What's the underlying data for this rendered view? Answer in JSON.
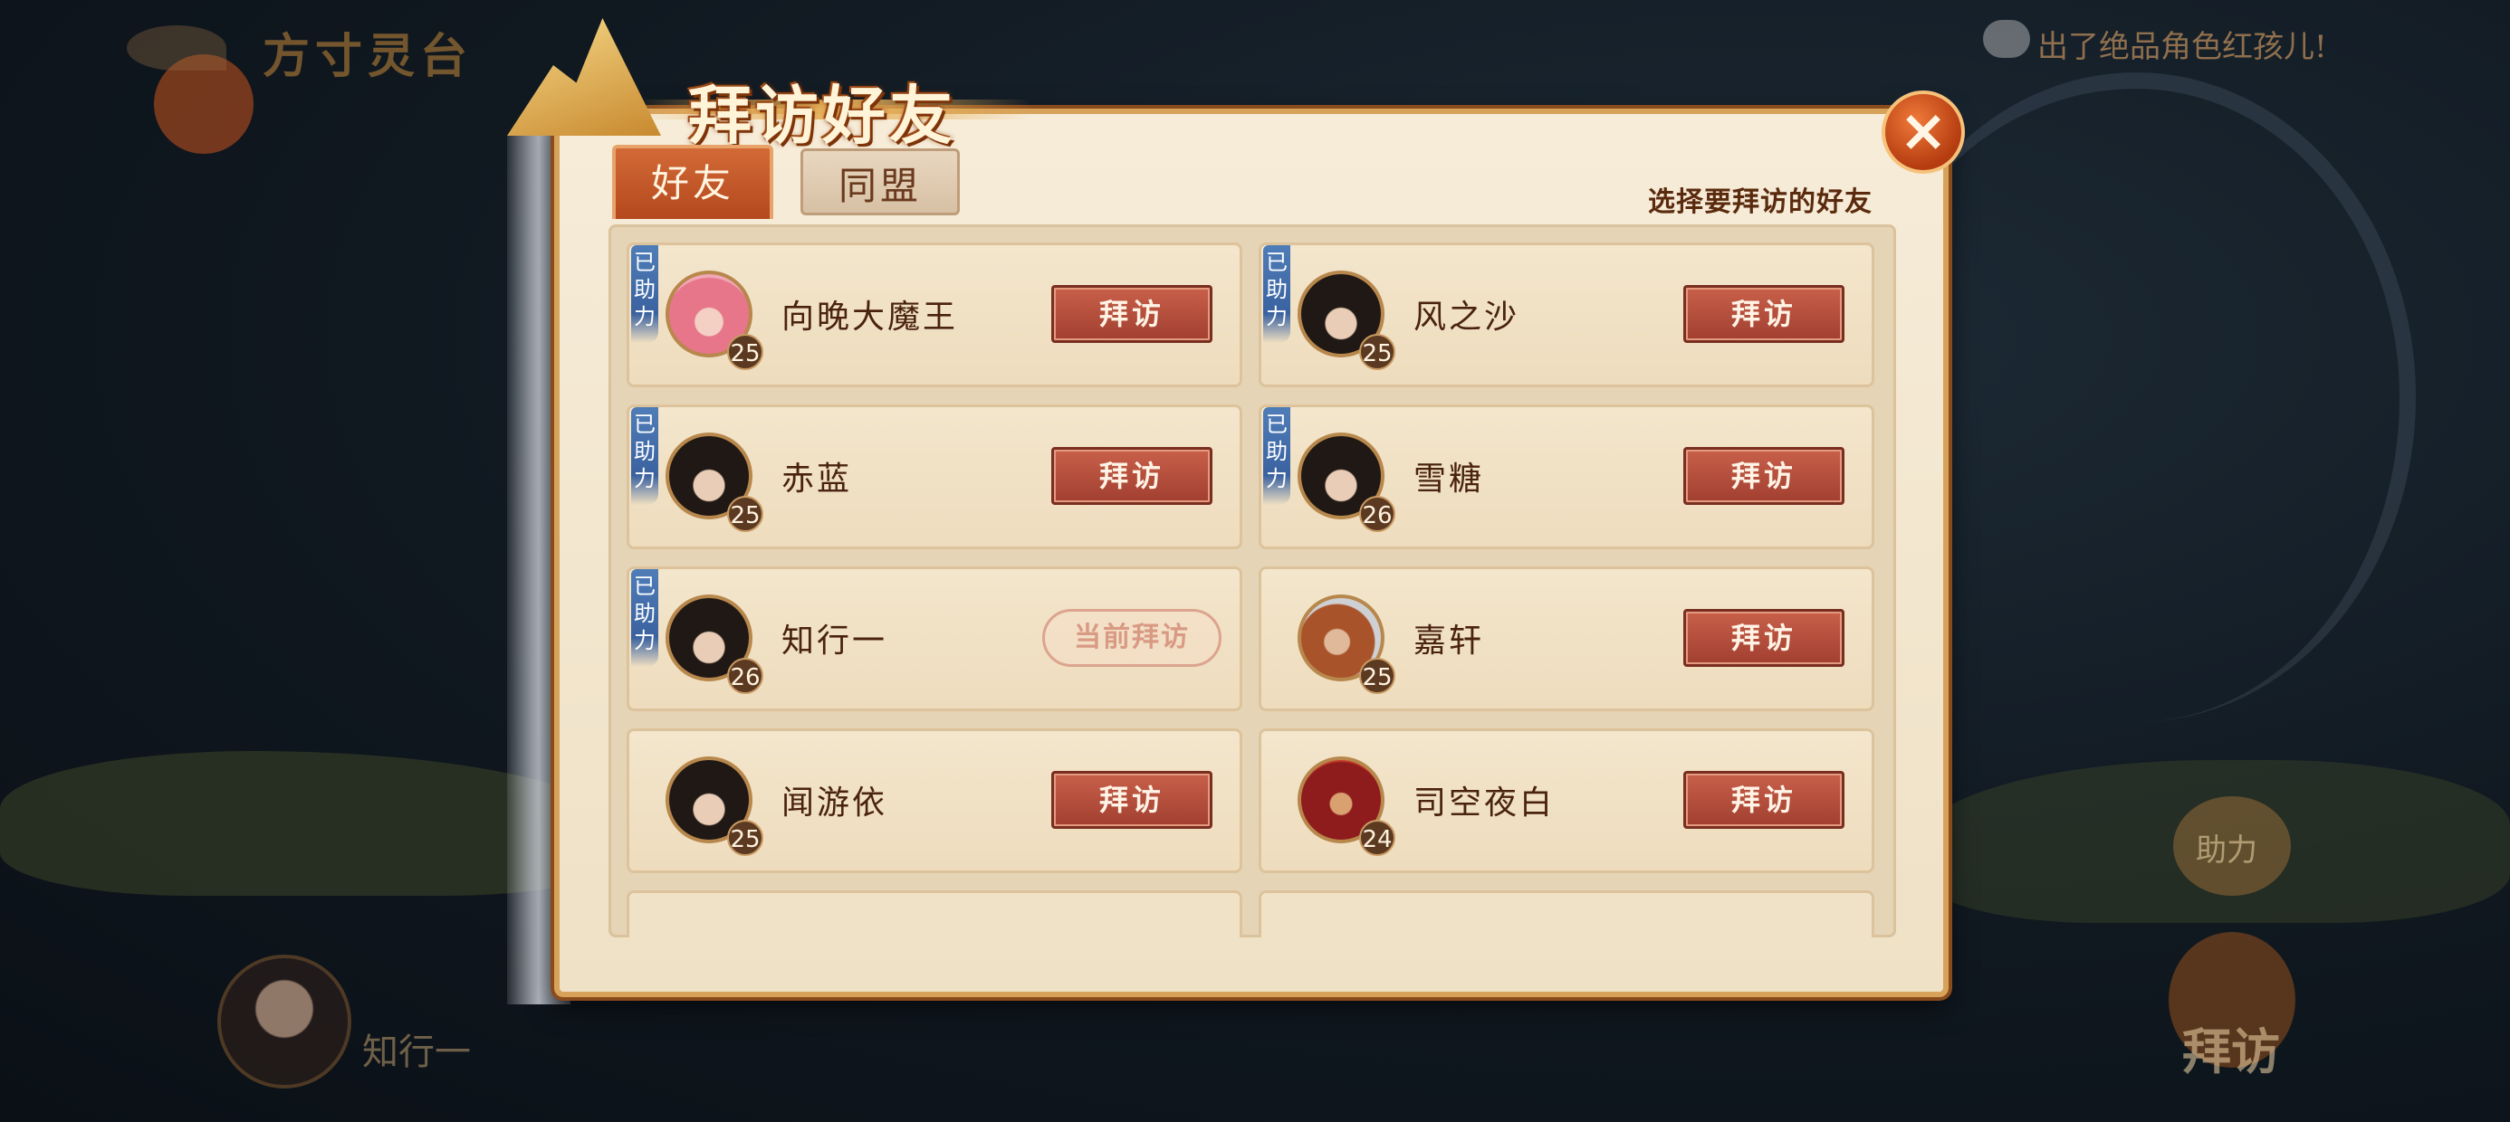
{
  "background": {
    "location_title": "方寸灵台",
    "chat_message": "出了绝品角色红孩儿!",
    "player_name": "知行一",
    "help_label": "助力",
    "visit_label": "拜访"
  },
  "dialog": {
    "title": "拜访好友",
    "close_icon": "×",
    "tabs": [
      {
        "label": "好友",
        "active": true
      },
      {
        "label": "同盟",
        "active": false
      }
    ],
    "hint": "选择要拜访的好友",
    "helped_tag": "已助力",
    "visit_button": "拜访",
    "current_visit": "当前拜访",
    "friends": [
      {
        "name": "向晚大魔王",
        "level": "25",
        "helped": true,
        "avatar": "pink-hair-avatar",
        "status": "visit"
      },
      {
        "name": "风之沙",
        "level": "25",
        "helped": true,
        "avatar": "dark-hair-avatar",
        "status": "visit"
      },
      {
        "name": "赤蓝",
        "level": "25",
        "helped": true,
        "avatar": "dark-hair-avatar",
        "status": "visit"
      },
      {
        "name": "雪糖",
        "level": "26",
        "helped": true,
        "avatar": "dark-hair-avatar",
        "status": "visit"
      },
      {
        "name": "知行一",
        "level": "26",
        "helped": true,
        "avatar": "dark-hair-avatar",
        "status": "current"
      },
      {
        "name": "嘉轩",
        "level": "25",
        "helped": false,
        "avatar": "brown-hair-avatar",
        "status": "visit"
      },
      {
        "name": "闻游依",
        "level": "25",
        "helped": false,
        "avatar": "dark-hair-avatar",
        "status": "visit"
      },
      {
        "name": "司空夜白",
        "level": "24",
        "helped": false,
        "avatar": "red-mask-avatar",
        "status": "visit"
      }
    ]
  }
}
